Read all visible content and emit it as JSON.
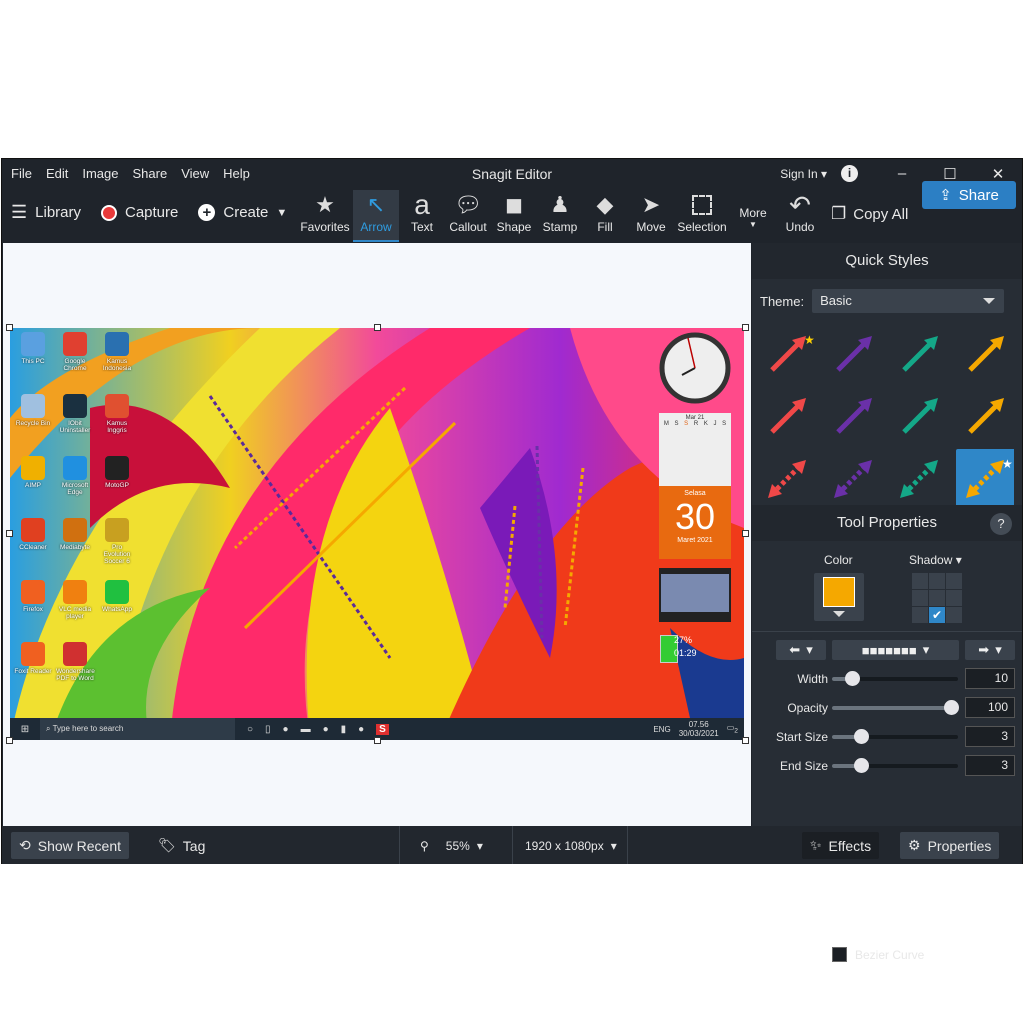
{
  "window": {
    "title": "Snagit Editor",
    "menu": [
      "File",
      "Edit",
      "Image",
      "Share",
      "View",
      "Help"
    ],
    "sign_in": "Sign In",
    "info": "i"
  },
  "toolbar": {
    "library": "Library",
    "capture": "Capture",
    "create": "Create",
    "tools": [
      {
        "label": "Favorites",
        "icon": "star-icon"
      },
      {
        "label": "Arrow",
        "icon": "arrow-icon",
        "active": true
      },
      {
        "label": "Text",
        "icon": "text-icon"
      },
      {
        "label": "Callout",
        "icon": "callout-icon"
      },
      {
        "label": "Shape",
        "icon": "shape-icon"
      },
      {
        "label": "Stamp",
        "icon": "stamp-icon"
      },
      {
        "label": "Fill",
        "icon": "fill-icon"
      },
      {
        "label": "Move",
        "icon": "move-icon"
      },
      {
        "label": "Selection",
        "icon": "selection-icon"
      }
    ],
    "more": "More",
    "undo": "Undo",
    "copy_all": "Copy All",
    "share": "Share"
  },
  "desktop": {
    "icons": [
      "This PC",
      "Google Chrome",
      "Kamus Indonesia",
      "Recycle Bin",
      "IObit Uninstaller",
      "Kamus Inggris",
      "AIMP",
      "Microsoft Edge",
      "MotoGP",
      "CCleaner",
      "Mediabyte",
      "Pro Evolution Soccer 6",
      "Firefox",
      "VLC media player",
      "WhatsApp",
      "Foxit Reader",
      "Wondershare PDF to Word"
    ],
    "calendar": {
      "month": "Mar 21",
      "days": [
        "M",
        "S",
        "S",
        "R",
        "K",
        "J",
        "S"
      ],
      "day_name": "Selasa",
      "day": "30",
      "month_year": "Maret 2021"
    },
    "battery": {
      "percent": "27%",
      "time": "01:29"
    },
    "taskbar": {
      "search": "Type here to search",
      "lang": "ENG",
      "time": "07.56",
      "date": "30/03/2021",
      "notifications": "2"
    }
  },
  "panel": {
    "quick_styles": "Quick Styles",
    "theme_label": "Theme:",
    "theme_value": "Basic",
    "style_colors": [
      "#f04848",
      "#6a30a8",
      "#14a888",
      "#f5a800"
    ],
    "tool_properties": "Tool Properties",
    "help": "?",
    "color_label": "Color",
    "color_value": "#f5a800",
    "shadow_label": "Shadow",
    "sliders": [
      {
        "label": "Width",
        "value": "10",
        "fraction": 0.12
      },
      {
        "label": "Opacity",
        "value": "100",
        "fraction": 1.0
      },
      {
        "label": "Start Size",
        "value": "3",
        "fraction": 0.2
      },
      {
        "label": "End Size",
        "value": "3",
        "fraction": 0.2
      }
    ],
    "bezier": "Bezier Curve"
  },
  "status": {
    "show_recent": "Show Recent",
    "tag": "Tag",
    "zoom": "55%",
    "dimensions": "1920 x 1080px",
    "effects": "Effects",
    "properties": "Properties"
  }
}
